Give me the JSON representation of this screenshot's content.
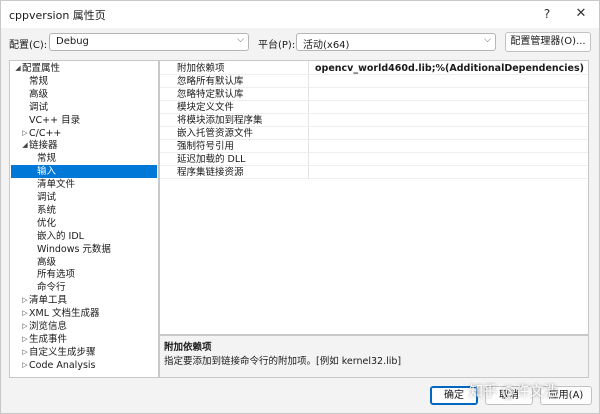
{
  "window": {
    "title": "cppversion 属性页",
    "help_glyph": "?",
    "close_glyph": "✕"
  },
  "toolbar": {
    "config_label": "配置(C):",
    "config_value": "Debug",
    "platform_label": "平台(P):",
    "platform_value": "活动(x64)",
    "config_manager_label": "配置管理器(O)..."
  },
  "tree": {
    "items": [
      {
        "label": "配置属性",
        "expander": "◢",
        "level": 0,
        "selected": false
      },
      {
        "label": "常规",
        "expander": "",
        "level": 1,
        "selected": false
      },
      {
        "label": "高级",
        "expander": "",
        "level": 1,
        "selected": false
      },
      {
        "label": "调试",
        "expander": "",
        "level": 1,
        "selected": false
      },
      {
        "label": "VC++ 目录",
        "expander": "",
        "level": 1,
        "selected": false
      },
      {
        "label": "C/C++",
        "expander": "▷",
        "level": 0.5,
        "selected": false
      },
      {
        "label": "链接器",
        "expander": "◢",
        "level": 0.5,
        "selected": false
      },
      {
        "label": "常规",
        "expander": "",
        "level": 2,
        "selected": false
      },
      {
        "label": "输入",
        "expander": "",
        "level": 2,
        "selected": true
      },
      {
        "label": "清单文件",
        "expander": "",
        "level": 2,
        "selected": false
      },
      {
        "label": "调试",
        "expander": "",
        "level": 2,
        "selected": false
      },
      {
        "label": "系统",
        "expander": "",
        "level": 2,
        "selected": false
      },
      {
        "label": "优化",
        "expander": "",
        "level": 2,
        "selected": false
      },
      {
        "label": "嵌入的 IDL",
        "expander": "",
        "level": 2,
        "selected": false
      },
      {
        "label": "Windows 元数据",
        "expander": "",
        "level": 2,
        "selected": false
      },
      {
        "label": "高级",
        "expander": "",
        "level": 2,
        "selected": false
      },
      {
        "label": "所有选项",
        "expander": "",
        "level": 2,
        "selected": false
      },
      {
        "label": "命令行",
        "expander": "",
        "level": 2,
        "selected": false
      },
      {
        "label": "清单工具",
        "expander": "▷",
        "level": 0.5,
        "selected": false
      },
      {
        "label": "XML 文档生成器",
        "expander": "▷",
        "level": 0.5,
        "selected": false
      },
      {
        "label": "浏览信息",
        "expander": "▷",
        "level": 0.5,
        "selected": false
      },
      {
        "label": "生成事件",
        "expander": "▷",
        "level": 0.5,
        "selected": false
      },
      {
        "label": "自定义生成步骤",
        "expander": "▷",
        "level": 0.5,
        "selected": false
      },
      {
        "label": "Code Analysis",
        "expander": "▷",
        "level": 0.5,
        "selected": false
      }
    ]
  },
  "properties": {
    "rows": [
      {
        "name": "附加依赖项",
        "value": "opencv_world460d.lib;%(AdditionalDependencies)"
      },
      {
        "name": "忽略所有默认库",
        "value": ""
      },
      {
        "name": "忽略特定默认库",
        "value": ""
      },
      {
        "name": "模块定义文件",
        "value": ""
      },
      {
        "name": "将模块添加到程序集",
        "value": ""
      },
      {
        "name": "嵌入托管资源文件",
        "value": ""
      },
      {
        "name": "强制符号引用",
        "value": ""
      },
      {
        "name": "延迟加载的 DLL",
        "value": ""
      },
      {
        "name": "程序集链接资源",
        "value": ""
      }
    ]
  },
  "description": {
    "title": "附加依赖项",
    "text": "指定要添加到链接命令行的附加项。[例如 kernel32.lib]"
  },
  "footer": {
    "ok_label": "确定",
    "cancel_label": "取消",
    "apply_label": "应用(A)"
  },
  "watermark": "知乎 @许文浩",
  "colors": {
    "selection": "#0078d7",
    "dialog_bg": "#f3f3f3",
    "border": "#c8c8c8"
  }
}
